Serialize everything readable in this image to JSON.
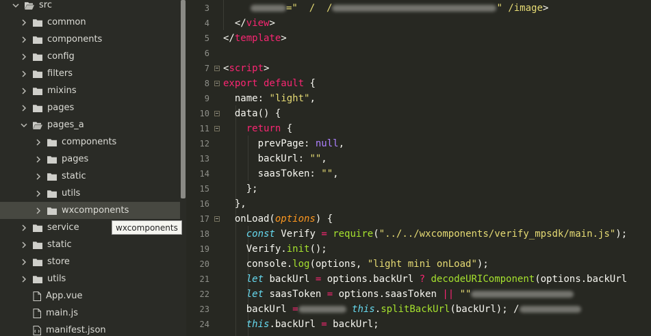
{
  "colors": {
    "sidebar_bg": "#2a2b26",
    "editor_bg": "#272822",
    "selected_row": "#474841",
    "keyword": "#f92672",
    "string": "#e6db74",
    "function": "#a6e22e",
    "type_italic": "#66d9ef",
    "number_null": "#ae81ff",
    "param": "#fd971f",
    "line_number": "#8f908a"
  },
  "sidebar": {
    "rows": [
      {
        "label": "src",
        "kind": "folder",
        "expanded": true,
        "depth": 0
      },
      {
        "label": "common",
        "kind": "folder",
        "expanded": false,
        "depth": 1
      },
      {
        "label": "components",
        "kind": "folder",
        "expanded": false,
        "depth": 1
      },
      {
        "label": "config",
        "kind": "folder",
        "expanded": false,
        "depth": 1
      },
      {
        "label": "filters",
        "kind": "folder",
        "expanded": false,
        "depth": 1
      },
      {
        "label": "mixins",
        "kind": "folder",
        "expanded": false,
        "depth": 1
      },
      {
        "label": "pages",
        "kind": "folder",
        "expanded": false,
        "depth": 1
      },
      {
        "label": "pages_a",
        "kind": "folder",
        "expanded": true,
        "depth": 1
      },
      {
        "label": "components",
        "kind": "folder",
        "expanded": false,
        "depth": 2
      },
      {
        "label": "pages",
        "kind": "folder",
        "expanded": false,
        "depth": 2
      },
      {
        "label": "static",
        "kind": "folder",
        "expanded": false,
        "depth": 2
      },
      {
        "label": "utils",
        "kind": "folder",
        "expanded": false,
        "depth": 2
      },
      {
        "label": "wxcomponents",
        "kind": "folder",
        "expanded": false,
        "depth": 2,
        "selected": true
      },
      {
        "label": "service",
        "kind": "folder",
        "expanded": false,
        "depth": 1
      },
      {
        "label": "static",
        "kind": "folder",
        "expanded": false,
        "depth": 1
      },
      {
        "label": "store",
        "kind": "folder",
        "expanded": false,
        "depth": 1
      },
      {
        "label": "utils",
        "kind": "folder",
        "expanded": false,
        "depth": 1
      },
      {
        "label": "App.vue",
        "kind": "file",
        "depth": 1
      },
      {
        "label": "main.js",
        "kind": "file",
        "depth": 1
      },
      {
        "label": "manifest.json",
        "kind": "file-json",
        "depth": 1
      }
    ],
    "tooltip": "wxcomponents"
  },
  "editor": {
    "line_numbers": [
      "3",
      "4",
      "5",
      "6",
      "7",
      "8",
      "9",
      "10",
      "11",
      "12",
      "13",
      "14",
      "15",
      "16",
      "17",
      "18",
      "19",
      "20",
      "21",
      "22",
      "23",
      "24"
    ],
    "lines": [
      {
        "segments": [
          {
            "c": "blur",
            "w": 52
          },
          {
            "t": "=\"  /  /",
            "k": "str"
          },
          {
            "c": "blur",
            "w": 240
          },
          {
            "t": "\" /image",
            "k": "str"
          },
          {
            "t": ">",
            "k": "plain"
          }
        ]
      },
      {
        "segments": [
          {
            "t": "  </",
            "k": "plain"
          },
          {
            "t": "view",
            "k": "tag"
          },
          {
            "t": ">",
            "k": "plain"
          }
        ]
      },
      {
        "segments": [
          {
            "t": "</",
            "k": "plain"
          },
          {
            "t": "template",
            "k": "tag"
          },
          {
            "t": ">",
            "k": "plain"
          }
        ]
      },
      {
        "segments": []
      },
      {
        "segments": [
          {
            "t": "<",
            "k": "plain"
          },
          {
            "t": "script",
            "k": "tag"
          },
          {
            "t": ">",
            "k": "plain"
          }
        ]
      },
      {
        "segments": [
          {
            "t": "export default",
            "k": "kw"
          },
          {
            "t": " {",
            "k": "plain"
          }
        ]
      },
      {
        "segments": [
          {
            "t": "  name: ",
            "k": "plain"
          },
          {
            "t": "\"light\"",
            "k": "str"
          },
          {
            "t": ",",
            "k": "plain"
          }
        ]
      },
      {
        "segments": [
          {
            "t": "  data() {",
            "k": "plain"
          }
        ]
      },
      {
        "segments": [
          {
            "t": "    ",
            "k": "plain"
          },
          {
            "t": "return",
            "k": "kw"
          },
          {
            "t": " {",
            "k": "plain"
          }
        ]
      },
      {
        "segments": [
          {
            "t": "      prevPage: ",
            "k": "plain"
          },
          {
            "t": "null",
            "k": "num"
          },
          {
            "t": ",",
            "k": "plain"
          }
        ]
      },
      {
        "segments": [
          {
            "t": "      backUrl: ",
            "k": "plain"
          },
          {
            "t": "\"\"",
            "k": "str"
          },
          {
            "t": ",",
            "k": "plain"
          }
        ]
      },
      {
        "segments": [
          {
            "t": "      saasToken: ",
            "k": "plain"
          },
          {
            "t": "\"\"",
            "k": "str"
          },
          {
            "t": ",",
            "k": "plain"
          }
        ]
      },
      {
        "segments": [
          {
            "t": "    };",
            "k": "plain"
          }
        ]
      },
      {
        "segments": [
          {
            "t": "  },",
            "k": "plain"
          }
        ]
      },
      {
        "segments": [
          {
            "t": "  onLoad(",
            "k": "plain"
          },
          {
            "t": "options",
            "k": "prm"
          },
          {
            "t": ") {",
            "k": "plain"
          }
        ]
      },
      {
        "segments": [
          {
            "t": "    ",
            "k": "plain"
          },
          {
            "t": "const",
            "k": "kit"
          },
          {
            "t": " Verify ",
            "k": "plain"
          },
          {
            "t": "=",
            "k": "kw"
          },
          {
            "t": " ",
            "k": "plain"
          },
          {
            "t": "require",
            "k": "fn"
          },
          {
            "t": "(",
            "k": "plain"
          },
          {
            "t": "\"../../wxcomponents/verify_mpsdk/main.js\"",
            "k": "str"
          },
          {
            "t": ");",
            "k": "plain"
          }
        ]
      },
      {
        "segments": [
          {
            "t": "    Verify.",
            "k": "plain"
          },
          {
            "t": "init",
            "k": "fn"
          },
          {
            "t": "();",
            "k": "plain"
          }
        ]
      },
      {
        "segments": [
          {
            "t": "    console.",
            "k": "plain"
          },
          {
            "t": "log",
            "k": "fn"
          },
          {
            "t": "(options, ",
            "k": "plain"
          },
          {
            "t": "\"light mini onLoad\"",
            "k": "str"
          },
          {
            "t": ");",
            "k": "plain"
          }
        ]
      },
      {
        "segments": [
          {
            "t": "    ",
            "k": "plain"
          },
          {
            "t": "let",
            "k": "kit"
          },
          {
            "t": " backUrl ",
            "k": "plain"
          },
          {
            "t": "=",
            "k": "kw"
          },
          {
            "t": " options.backUrl ",
            "k": "plain"
          },
          {
            "t": "?",
            "k": "kw"
          },
          {
            "t": " ",
            "k": "plain"
          },
          {
            "t": "decodeURIComponent",
            "k": "fn"
          },
          {
            "t": "(options.backUrl",
            "k": "plain"
          }
        ]
      },
      {
        "segments": [
          {
            "t": "    ",
            "k": "plain"
          },
          {
            "t": "let",
            "k": "kit"
          },
          {
            "t": " saasToken ",
            "k": "plain"
          },
          {
            "t": "=",
            "k": "kw"
          },
          {
            "t": " options.saasToken ",
            "k": "plain"
          },
          {
            "t": "||",
            "k": "kw"
          },
          {
            "t": " ",
            "k": "plain"
          },
          {
            "t": "\"\"",
            "k": "str"
          },
          {
            "c": "blur",
            "w": 150
          }
        ]
      },
      {
        "segments": [
          {
            "t": "    backUrl ",
            "k": "plain"
          },
          {
            "t": "=",
            "k": "kw"
          },
          {
            "c": "blur",
            "w": 70
          },
          {
            "t": " this",
            "k": "kit"
          },
          {
            "t": ".",
            "k": "plain"
          },
          {
            "t": "splitBackUrl",
            "k": "fn"
          },
          {
            "t": "(backUrl); /",
            "k": "plain"
          },
          {
            "c": "blur",
            "w": 90
          }
        ]
      },
      {
        "segments": [
          {
            "t": "    ",
            "k": "plain"
          },
          {
            "t": "this",
            "k": "kit"
          },
          {
            "t": ".backUrl ",
            "k": "plain"
          },
          {
            "t": "=",
            "k": "kw"
          },
          {
            "t": " backUrl;",
            "k": "plain"
          }
        ]
      }
    ]
  }
}
